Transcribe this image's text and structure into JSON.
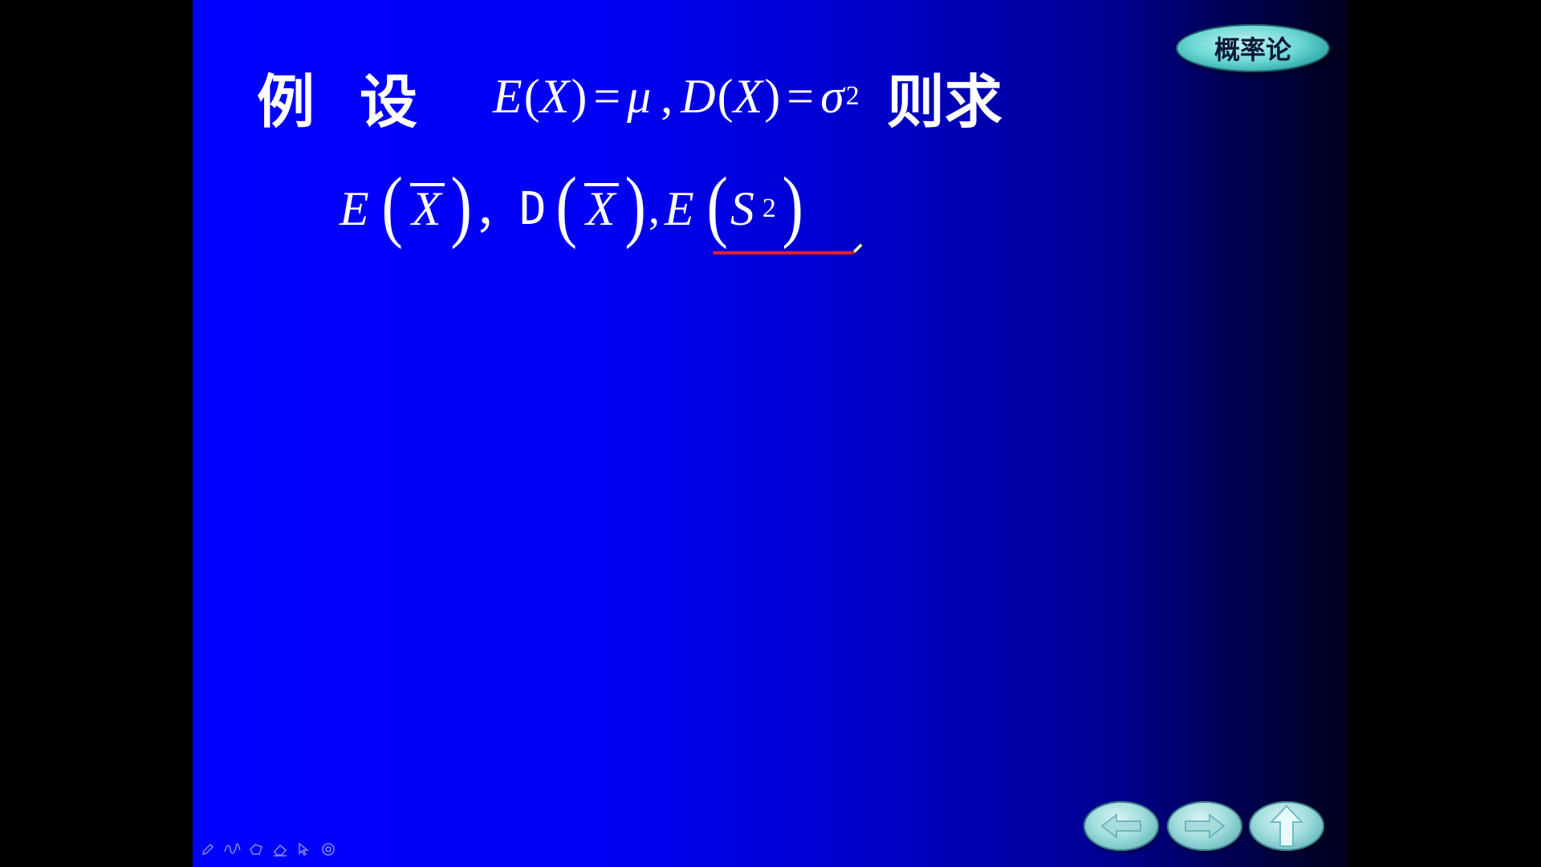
{
  "slide": {
    "line1": {
      "word_example": "例",
      "word_let": "设",
      "E": "E",
      "D": "D",
      "X": "X",
      "lparen": "(",
      "rparen": ")",
      "equals": "=",
      "mu": "μ",
      "comma": ",",
      "sigma": "σ",
      "exp2": "2",
      "word_then_find": "则求"
    },
    "line2": {
      "E": "E",
      "D": "D",
      "X": "X",
      "S": "S",
      "exp2": "2",
      "lparen": "(",
      "rparen": ")",
      "comma_cjk": "，",
      "comma": ","
    }
  },
  "badge": {
    "label": "概率论"
  },
  "nav": {
    "prev_icon": "arrow-left-icon",
    "next_icon": "arrow-right-icon",
    "up_icon": "arrow-up-icon"
  },
  "toolbar": {
    "icons": [
      "pen-icon",
      "freehand-icon",
      "shape-icon",
      "eraser-icon",
      "pointer-icon",
      "target-icon"
    ]
  },
  "colors": {
    "slide_gradient_start": "#0000ff",
    "slide_gradient_end": "#00001c",
    "text": "#ffffff",
    "annotation_line": "#e3202e",
    "badge_teal": "#6dd8d4"
  }
}
